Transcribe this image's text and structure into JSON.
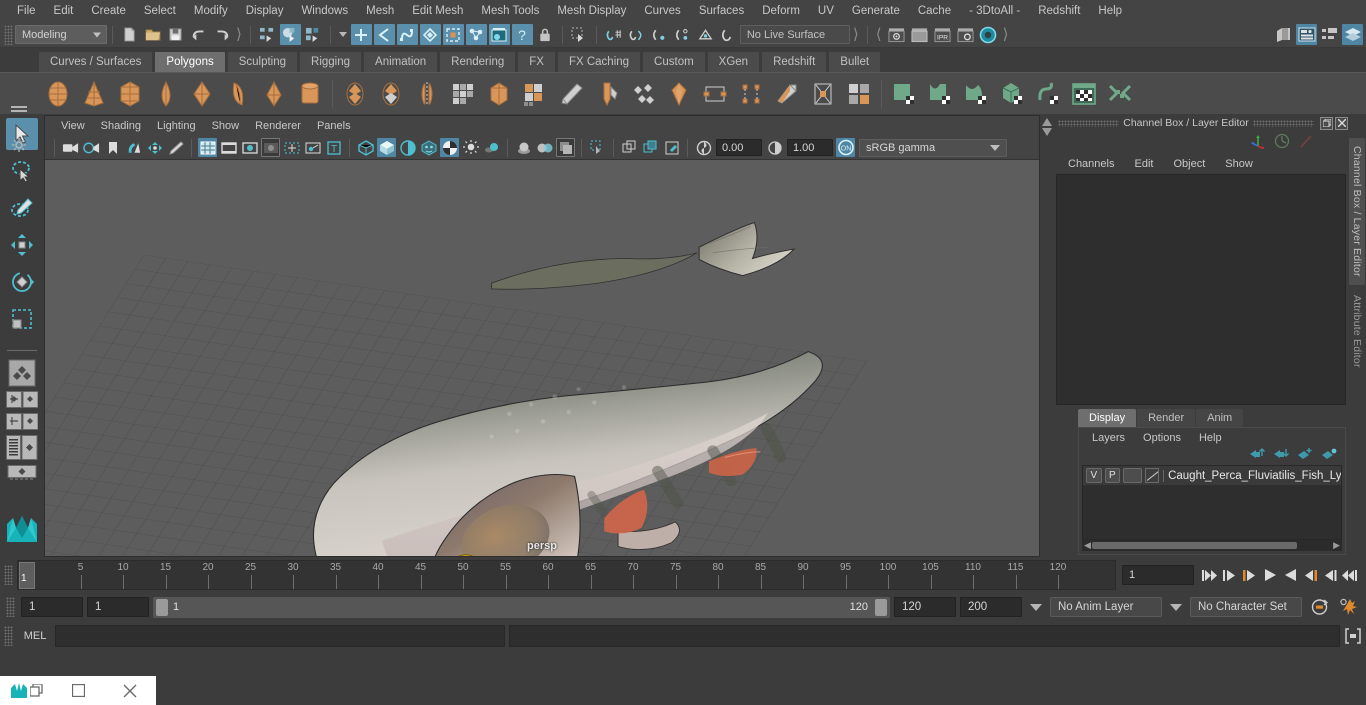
{
  "menubar": {
    "items": [
      "File",
      "Edit",
      "Create",
      "Select",
      "Modify",
      "Display",
      "Windows",
      "Mesh",
      "Edit Mesh",
      "Mesh Tools",
      "Mesh Display",
      "Curves",
      "Surfaces",
      "Deform",
      "UV",
      "Generate",
      "Cache",
      "- 3DtoAll -",
      "Redshift",
      "Help"
    ]
  },
  "statusline": {
    "menu_set": "Modeling",
    "live_surface": "No Live Surface",
    "icons": {
      "new_scene": "new-scene-icon",
      "open_scene": "open-scene-icon",
      "save_scene": "save-scene-icon",
      "undo": "undo-icon",
      "redo": "redo-icon",
      "select_hierarchy": "select-by-hierarchy-icon",
      "select_object": "select-by-object-type-icon",
      "select_component": "select-by-component-type-icon",
      "mask_handle": "mask-handle-icon",
      "mask_curve": "mask-curve-icon",
      "mask_surface": "mask-surface-icon",
      "mask_deform": "mask-deformation-icon",
      "mask_dynamic": "mask-dynamic-icon",
      "mask_render": "mask-rendering-icon",
      "mask_misc": "mask-misc-icon",
      "lock_selection": "lock-selection-icon",
      "snap_grid": "snap-to-grid-icon",
      "snap_curve": "snap-to-curve-icon",
      "snap_point": "snap-to-point-icon",
      "snap_projected": "snap-to-projected-center-icon",
      "snap_view_plane": "snap-to-view-plane-icon",
      "construction_history": "construction-history-icon",
      "render_current": "render-current-frame-icon",
      "render_sequence": "render-sequence-icon",
      "ipr_render": "ipr-render-icon",
      "render_settings": "render-settings-icon",
      "hypershade": "hypershade-icon",
      "show_hide_editors": "sidebar-toggle-icon",
      "show_attribute_editor": "attribute-editor-toggle-icon",
      "show_tool_settings": "tool-settings-toggle-icon",
      "show_channel_box": "channel-box-toggle-icon"
    }
  },
  "shelf": {
    "tabs": [
      "Curves / Surfaces",
      "Polygons",
      "Sculpting",
      "Rigging",
      "Animation",
      "Rendering",
      "FX",
      "FX Caching",
      "Custom",
      "XGen",
      "Redshift",
      "Bullet"
    ],
    "active_tab": "Polygons",
    "icons": [
      "poly-sphere-icon",
      "poly-cone-icon",
      "poly-cube-icon",
      "poly-cylinder-icon",
      "poly-torus-icon",
      "poly-plane-icon",
      "poly-prism-icon",
      "poly-pipe-icon",
      "poly-combine-icon",
      "poly-separate-icon",
      "poly-mirror-icon",
      "poly-smooth-icon",
      "poly-bevel-icon",
      "poly-extrude-icon",
      "poly-multicut-icon",
      "poly-target-weld-icon",
      "poly-merge-icon",
      "poly-append-icon",
      "poly-quad-draw-icon",
      "poly-crease-icon",
      "poly-sculpt-icon",
      "poly-uv-icon",
      "poly-reduce-icon",
      "nurbs-plane-icon",
      "nurbs-surface-icon",
      "nurbs-patch-icon",
      "nurbs-cube-icon",
      "nurbs-curve-icon",
      "nurbs-editor-icon",
      "nurbs-intersect-icon"
    ]
  },
  "viewport": {
    "menus": [
      "View",
      "Shading",
      "Lighting",
      "Show",
      "Renderer",
      "Panels"
    ],
    "camera_label": "persp",
    "exposure": "0.00",
    "gamma": "1.00",
    "color_management": "sRGB gamma",
    "toolbar_icons": [
      "camera-select-icon",
      "camera-attributes-icon",
      "bookmark-icon",
      "image-plane-icon",
      "2d-pan-zoom-icon",
      "grease-pencil-icon",
      "grid-toggle-icon",
      "film-gate-icon",
      "resolution-gate-icon",
      "gate-mask-icon",
      "film-origin-icon",
      "xray-joints-icon",
      "text-overlay-icon",
      "wireframe-shading-icon",
      "smooth-shading-icon",
      "shaded-wireframe-icon",
      "textured-shading-icon",
      "use-all-lights-icon",
      "shadows-icon",
      "ambient-occlusion-icon",
      "motion-blur-icon",
      "multisample-icon",
      "isolate-select-icon",
      "xray-icon",
      "xray-active-components-icon",
      "exposure-icon",
      "gamma-icon",
      "color-management-toggle-icon"
    ]
  },
  "channel_box": {
    "panel_title": "Channel Box / Layer Editor",
    "menus": [
      "Channels",
      "Edit",
      "Object",
      "Show"
    ],
    "window_buttons": [
      "undock-icon",
      "close-icon"
    ],
    "header_icons": [
      "manipulator-axis-icon",
      "speedometer-icon",
      "slash-icon"
    ]
  },
  "layer_editor": {
    "tabs": [
      "Display",
      "Render",
      "Anim"
    ],
    "active_tab": "Display",
    "menus": [
      "Layers",
      "Options",
      "Help"
    ],
    "buttons": [
      "move-layer-up-icon",
      "move-layer-down-icon",
      "new-layer-icon",
      "new-layer-from-selected-icon"
    ],
    "layers": [
      {
        "visibility": "V",
        "playback": "P",
        "state": "",
        "name": "Caught_Perca_Fluviatilis_Fish_Lying_C"
      }
    ]
  },
  "side_tabs": [
    {
      "label": "Channel Box / Layer Editor",
      "active": true
    },
    {
      "label": "Attribute Editor",
      "active": false
    }
  ],
  "timeline": {
    "tick_labels": [
      5,
      10,
      15,
      20,
      25,
      30,
      35,
      40,
      45,
      50,
      55,
      60,
      65,
      70,
      75,
      80,
      85,
      90,
      95,
      100,
      105,
      110,
      115,
      120
    ],
    "current_frame": "1",
    "frame_field": "1",
    "playback_buttons": [
      "go-to-start-icon",
      "step-back-keyframe-icon",
      "step-back-frame-icon",
      "play-backwards-icon",
      "play-forwards-icon",
      "step-forward-frame-icon",
      "step-forward-keyframe-icon",
      "go-to-end-icon"
    ]
  },
  "range_slider": {
    "anim_start": "1",
    "range_start": "1",
    "bar_start_label": "1",
    "bar_end_label": "120",
    "range_end": "120",
    "anim_end": "200",
    "anim_layer": "No Anim Layer",
    "character_set": "No Character Set",
    "right_icons": [
      "auto-keyframe-icon",
      "animation-preferences-icon"
    ]
  },
  "command_line": {
    "language_label": "MEL",
    "input_value": "",
    "output_value": "",
    "help_icon": "script-editor-icon"
  },
  "taskbar": {
    "buttons": [
      "app-icon",
      "restore-window-icon",
      "maximize-window-icon",
      "close-window-icon"
    ]
  },
  "toolbox": {
    "tools": [
      {
        "name": "select-tool",
        "active": true
      },
      {
        "name": "lasso-select-tool",
        "active": false
      },
      {
        "name": "paint-select-tool",
        "active": false
      },
      {
        "name": "move-tool",
        "active": false
      },
      {
        "name": "rotate-tool",
        "active": false
      },
      {
        "name": "scale-tool",
        "active": false
      }
    ],
    "layouts": [
      "single-perspective-layout",
      "four-view-layout",
      "persp-outliner-layout",
      "persp-graph-layout",
      "hypershade-layout"
    ],
    "logo": "maya-logo-icon"
  },
  "colors": {
    "accent_blue": "#5b90ad",
    "shelf_orange": "#d99659",
    "shelf_green": "#6fa98a",
    "panel_bg": "#3c3c3c",
    "viewport_bg": "#5d5d5d",
    "field_bg": "#2b2b2b",
    "highlight_orange": "#e0853a"
  }
}
